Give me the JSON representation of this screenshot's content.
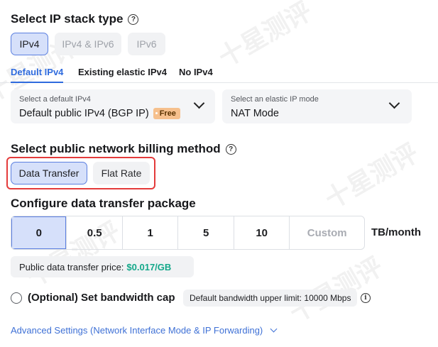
{
  "ip_stack": {
    "title": "Select IP stack type",
    "options": [
      {
        "label": "IPv4",
        "state": "selected"
      },
      {
        "label": "IPv4 & IPv6",
        "state": "disabled"
      },
      {
        "label": "IPv6",
        "state": "disabled"
      }
    ]
  },
  "tabs": [
    "Default IPv4",
    "Existing elastic IPv4",
    "No IPv4"
  ],
  "default_ipv4": {
    "label": "Select a default IPv4",
    "value": "Default public IPv4 (BGP IP)",
    "badge": "Free"
  },
  "elastic_mode": {
    "label": "Select an elastic IP mode",
    "value": "NAT Mode"
  },
  "billing": {
    "title": "Select public network billing method",
    "options": [
      "Data Transfer",
      "Flat Rate"
    ],
    "selected": "Data Transfer"
  },
  "package": {
    "title": "Configure data transfer package",
    "options": [
      "0",
      "0.5",
      "1",
      "5",
      "10",
      "Custom"
    ],
    "selected": "0",
    "unit": "TB/month"
  },
  "price": {
    "label": "Public data transfer price:",
    "value": "$0.017/GB"
  },
  "bandwidth": {
    "label": "(Optional) Set bandwidth cap",
    "default_limit": "Default bandwidth upper limit: 10000 Mbps"
  },
  "advanced": {
    "label": "Advanced Settings (Network Interface Mode & IP Forwarding)"
  },
  "watermark": "十星测评",
  "colors": {
    "accent": "#2f6bde",
    "selected_bg": "#d6e0fa",
    "price_green": "#14a88a",
    "badge_orange": "#f6c08d",
    "highlight_red": "#e43b3b"
  }
}
